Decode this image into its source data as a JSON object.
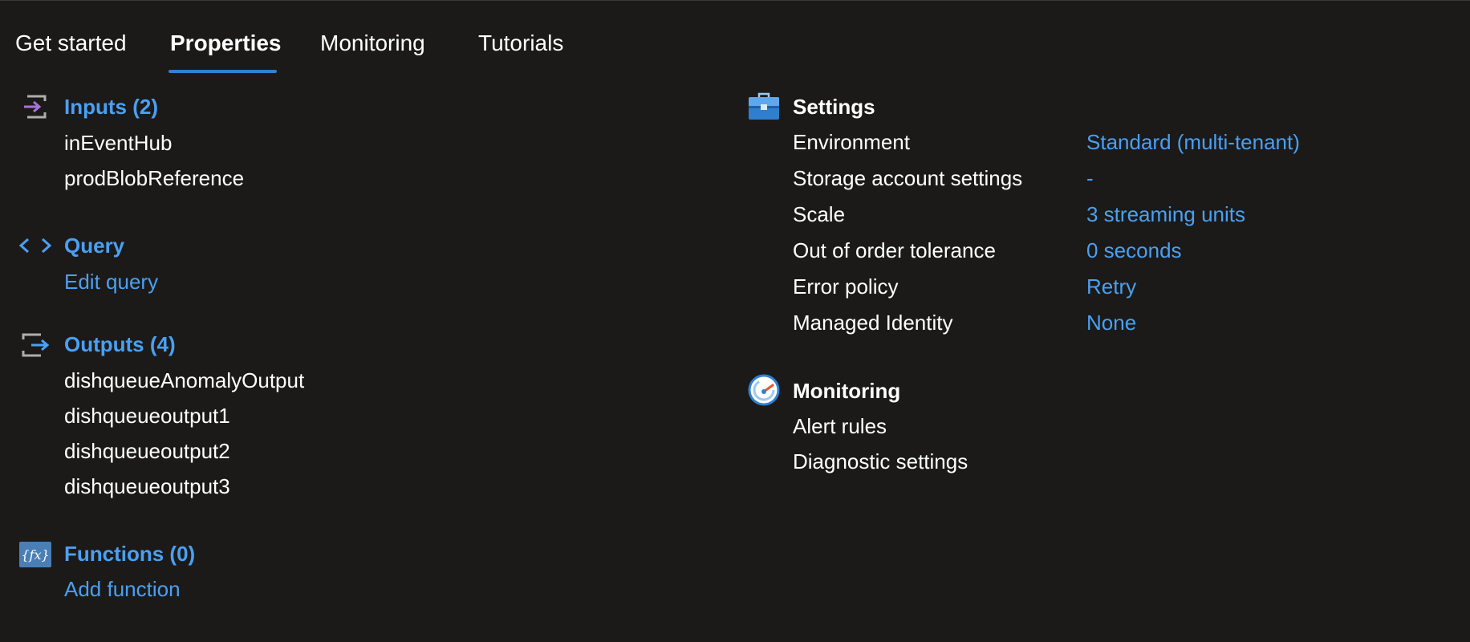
{
  "tabs": [
    {
      "label": "Get started"
    },
    {
      "label": "Properties"
    },
    {
      "label": "Monitoring"
    },
    {
      "label": "Tutorials"
    }
  ],
  "active_tab": "Properties",
  "inputs": {
    "title": "Inputs (2)",
    "items": [
      "inEventHub",
      "prodBlobReference"
    ]
  },
  "query": {
    "title": "Query",
    "link": "Edit query"
  },
  "outputs": {
    "title": "Outputs (4)",
    "items": [
      "dishqueueAnomalyOutput",
      "dishqueueoutput1",
      "dishqueueoutput2",
      "dishqueueoutput3"
    ]
  },
  "functions": {
    "title": "Functions (0)",
    "link": "Add function"
  },
  "settings": {
    "title": "Settings",
    "rows": [
      {
        "label": "Environment",
        "value": "Standard (multi-tenant)"
      },
      {
        "label": "Storage account settings",
        "value": "-"
      },
      {
        "label": "Scale",
        "value": "3 streaming units"
      },
      {
        "label": "Out of order tolerance",
        "value": "0 seconds"
      },
      {
        "label": "Error policy",
        "value": "Retry"
      },
      {
        "label": "Managed Identity",
        "value": "None"
      }
    ]
  },
  "monitoring": {
    "title": "Monitoring",
    "items": [
      "Alert rules",
      "Diagnostic settings"
    ]
  },
  "colors": {
    "background": "#1b1a19",
    "link": "#4aa0f3",
    "accent_underline": "#2f81d3",
    "text": "#ffffff"
  },
  "icons": {
    "inputs": "input-icon",
    "query": "code-brackets-icon",
    "outputs": "output-icon",
    "functions": "function-icon",
    "settings": "toolbox-icon",
    "monitoring": "gauge-icon"
  }
}
